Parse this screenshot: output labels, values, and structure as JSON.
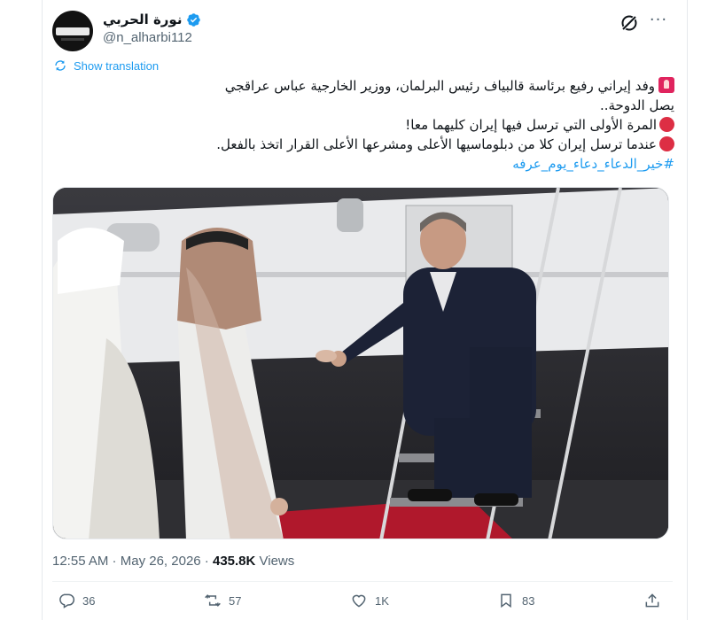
{
  "author": {
    "display_name": "نورة الحربي",
    "handle": "@n_alharbi112",
    "verified": true
  },
  "header_actions": {
    "grok_icon": "grok-icon",
    "more_icon": "more-horizontal-icon",
    "more_label": "···"
  },
  "translation": {
    "label": "Show translation",
    "icon": "translate-icon"
  },
  "post": {
    "line1": "وفد إيراني رفيع برئاسة قالبياف رئيس البرلمان، ووزير الخارجية عباس عراقجي",
    "line2": "يصل الدوحة..",
    "line3": "المرة الأولى التي ترسل فيها إيران كليهما معا!",
    "line4": "عندما ترسل إيران كلا من دبلوماسيها الأعلى ومشرعها الأعلى القرار اتخذ بالفعل.",
    "hashtag": "#خير_الدعاء_دعاء_يوم_عرفه"
  },
  "media": {
    "description_icon": "video-still"
  },
  "meta": {
    "time": "12:55 AM",
    "separator1": " · ",
    "date": "May 26, 2026",
    "separator2": " · ",
    "views_count": "435.8K",
    "views_label": " Views"
  },
  "actions": {
    "replies": "36",
    "reposts": "57",
    "likes": "1K",
    "bookmarks": "83"
  },
  "colors": {
    "accent": "#1d9bf0",
    "text": "#0f1419",
    "muted": "#536471",
    "verified": "#1d9bf0",
    "emoji_red": "#dd2e44"
  }
}
